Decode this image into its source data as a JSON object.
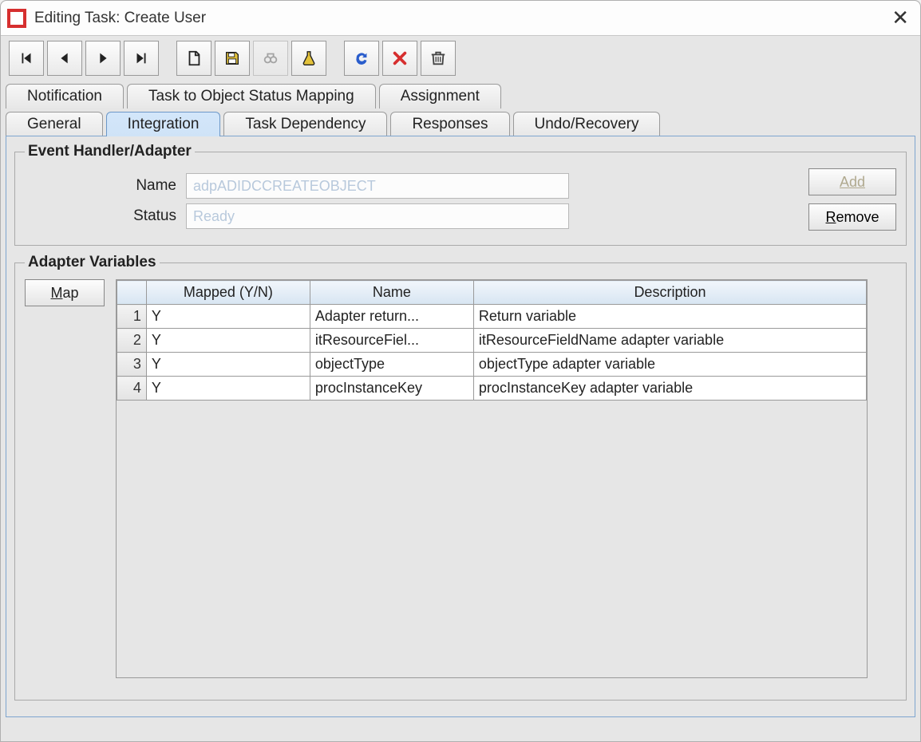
{
  "window": {
    "title": "Editing Task: Create User"
  },
  "tabs_row1": [
    {
      "label": "Notification"
    },
    {
      "label": "Task to Object Status Mapping"
    },
    {
      "label": "Assignment"
    }
  ],
  "tabs_row2": [
    {
      "label": "General"
    },
    {
      "label": "Integration",
      "active": true
    },
    {
      "label": "Task Dependency"
    },
    {
      "label": "Responses"
    },
    {
      "label": "Undo/Recovery"
    }
  ],
  "event_handler": {
    "legend": "Event Handler/Adapter",
    "name_label": "Name",
    "name_value": "adpADIDCCREATEOBJECT",
    "status_label": "Status",
    "status_value": "Ready",
    "add_label": "Add",
    "remove_label": "Remove"
  },
  "adapter_vars": {
    "legend": "Adapter Variables",
    "map_label": "Map",
    "columns": {
      "mapped": "Mapped (Y/N)",
      "name": "Name",
      "description": "Description"
    },
    "rows": [
      {
        "n": "1",
        "mapped": "Y",
        "name": "Adapter return...",
        "desc": "Return variable"
      },
      {
        "n": "2",
        "mapped": "Y",
        "name": "itResourceFiel...",
        "desc": "itResourceFieldName adapter variable"
      },
      {
        "n": "3",
        "mapped": "Y",
        "name": "objectType",
        "desc": "objectType adapter variable"
      },
      {
        "n": "4",
        "mapped": "Y",
        "name": "procInstanceKey",
        "desc": "procInstanceKey adapter variable"
      }
    ]
  }
}
